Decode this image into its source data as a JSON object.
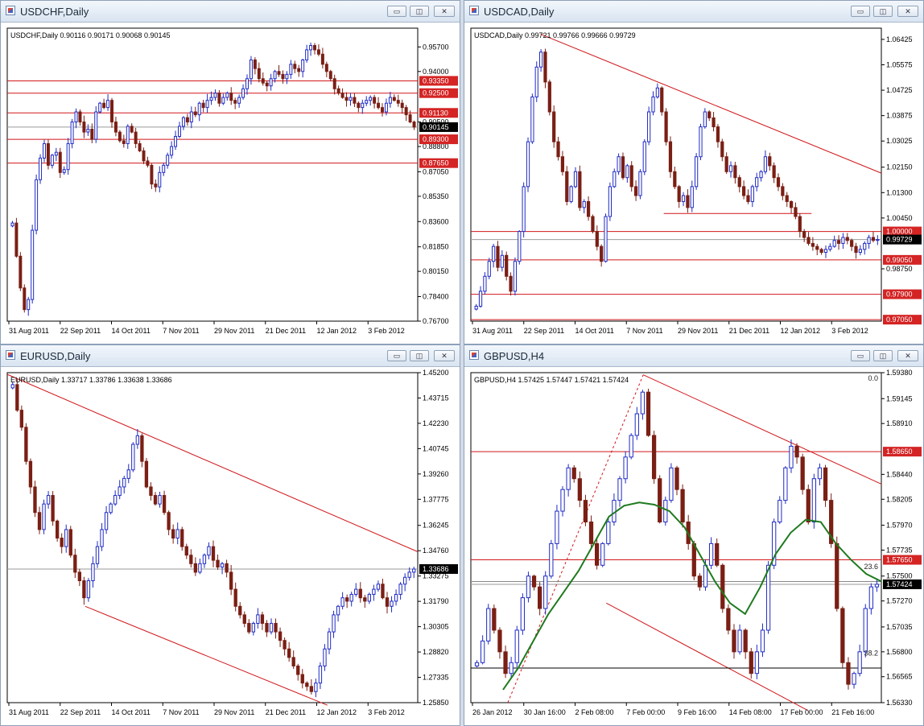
{
  "colors": {
    "up": "#1f2bc4",
    "down": "#7a1f14",
    "line": "#d1161a",
    "green": "#1f7a1f",
    "axis": "#000000",
    "price_box": "#d42424"
  },
  "window_controls": {
    "minimize": "▭",
    "restore": "◫",
    "close": "✕"
  },
  "chart_data": [
    {
      "id": "usdchf",
      "type": "candlestick",
      "window_title": "USDCHF,Daily",
      "info": "USDCHF,Daily  0.90116 0.90171 0.90068 0.90145",
      "ylim": [
        0.767,
        0.97
      ],
      "y_ticks": [
        {
          "v": 0.957,
          "t": "0.95700"
        },
        {
          "v": 0.94,
          "t": "0.94000"
        },
        {
          "v": 0.905,
          "t": "0.90500"
        },
        {
          "v": 0.888,
          "t": "0.88800"
        },
        {
          "v": 0.8705,
          "t": "0.87050"
        },
        {
          "v": 0.8535,
          "t": "0.85350"
        },
        {
          "v": 0.836,
          "t": "0.83600"
        },
        {
          "v": 0.8185,
          "t": "0.81850"
        },
        {
          "v": 0.8015,
          "t": "0.80150"
        },
        {
          "v": 0.784,
          "t": "0.78400"
        },
        {
          "v": 0.767,
          "t": "0.76700"
        }
      ],
      "x_ticks": [
        "31 Aug 2011",
        "22 Sep 2011",
        "14 Oct 2011",
        "7 Nov 2011",
        "29 Nov 2011",
        "21 Dec 2011",
        "12 Jan 2012",
        "3 Feb 2012"
      ],
      "h_lines": [
        {
          "v": 0.9335,
          "t": "0.93350"
        },
        {
          "v": 0.925,
          "t": "0.92500"
        },
        {
          "v": 0.9113,
          "t": "0.91130"
        },
        {
          "v": 0.893,
          "t": "0.89300"
        },
        {
          "v": 0.8765,
          "t": "0.87650"
        }
      ],
      "current": {
        "v": 0.90145,
        "t": "0.90145"
      },
      "closes": [
        0.835,
        0.812,
        0.79,
        0.775,
        0.782,
        0.83,
        0.865,
        0.88,
        0.89,
        0.875,
        0.882,
        0.884,
        0.87,
        0.872,
        0.89,
        0.905,
        0.912,
        0.905,
        0.898,
        0.9,
        0.893,
        0.912,
        0.918,
        0.915,
        0.92,
        0.905,
        0.898,
        0.892,
        0.89,
        0.902,
        0.898,
        0.89,
        0.885,
        0.878,
        0.875,
        0.862,
        0.86,
        0.87,
        0.875,
        0.882,
        0.888,
        0.895,
        0.902,
        0.908,
        0.905,
        0.912,
        0.91,
        0.918,
        0.915,
        0.92,
        0.922,
        0.925,
        0.918,
        0.922,
        0.925,
        0.92,
        0.918,
        0.922,
        0.928,
        0.935,
        0.948,
        0.942,
        0.935,
        0.932,
        0.93,
        0.935,
        0.94,
        0.938,
        0.935,
        0.938,
        0.945,
        0.942,
        0.94,
        0.948,
        0.955,
        0.958,
        0.955,
        0.952,
        0.945,
        0.94,
        0.935,
        0.928,
        0.925,
        0.922,
        0.92,
        0.922,
        0.918,
        0.915,
        0.918,
        0.92,
        0.922,
        0.918,
        0.915,
        0.912,
        0.918,
        0.922,
        0.92,
        0.918,
        0.915,
        0.91,
        0.905,
        0.90145
      ]
    },
    {
      "id": "usdcad",
      "type": "candlestick",
      "window_title": "USDCAD,Daily",
      "info": "USDCAD,Daily  0.99721 0.99766 0.99666 0.99729",
      "ylim": [
        0.97,
        1.068
      ],
      "y_ticks": [
        {
          "v": 1.06425,
          "t": "1.06425"
        },
        {
          "v": 1.05575,
          "t": "1.05575"
        },
        {
          "v": 1.04725,
          "t": "1.04725"
        },
        {
          "v": 1.03875,
          "t": "1.03875"
        },
        {
          "v": 1.03025,
          "t": "1.03025"
        },
        {
          "v": 1.0215,
          "t": "1.02150"
        },
        {
          "v": 1.013,
          "t": "1.01300"
        },
        {
          "v": 1.0045,
          "t": "1.00450"
        },
        {
          "v": 0.9875,
          "t": "0.98750"
        }
      ],
      "x_ticks": [
        "31 Aug 2011",
        "22 Sep 2011",
        "14 Oct 2011",
        "7 Nov 2011",
        "29 Nov 2011",
        "21 Dec 2011",
        "12 Jan 2012",
        "3 Feb 2012"
      ],
      "h_lines": [
        {
          "v": 1.0,
          "t": "1.00000"
        },
        {
          "v": 0.9905,
          "t": "0.99050"
        },
        {
          "v": 0.979,
          "t": "0.97900"
        },
        {
          "v": 0.9705,
          "t": "0.97050"
        }
      ],
      "current": {
        "v": 0.99729,
        "t": "0.99729"
      },
      "closes": [
        0.975,
        0.98,
        0.985,
        0.99,
        0.995,
        0.988,
        0.992,
        0.985,
        0.98,
        0.99,
        1.0,
        1.015,
        1.03,
        1.045,
        1.055,
        1.06,
        1.05,
        1.04,
        1.03,
        1.025,
        1.02,
        1.01,
        1.015,
        1.02,
        1.008,
        1.01,
        1.005,
        1.0,
        0.995,
        0.99,
        1.005,
        1.015,
        1.02,
        1.025,
        1.018,
        1.022,
        1.015,
        1.012,
        1.02,
        1.03,
        1.04,
        1.045,
        1.048,
        1.04,
        1.03,
        1.02,
        1.015,
        1.01,
        1.012,
        1.008,
        1.015,
        1.025,
        1.035,
        1.04,
        1.038,
        1.035,
        1.03,
        1.025,
        1.02,
        1.022,
        1.018,
        1.015,
        1.012,
        1.01,
        1.015,
        1.018,
        1.02,
        1.025,
        1.022,
        1.018,
        1.015,
        1.012,
        1.01,
        1.008,
        1.005,
        1.0,
        0.998,
        0.996,
        0.995,
        0.994,
        0.993,
        0.994,
        0.995,
        0.997,
        0.996,
        0.998,
        0.997,
        0.995,
        0.993,
        0.994,
        0.996,
        0.998,
        0.997,
        0.99729
      ]
    },
    {
      "id": "eurusd",
      "type": "candlestick",
      "window_title": "EURUSD,Daily",
      "info": "EURUSD,Daily  1.33717 1.33786 1.33638 1.33686",
      "ylim": [
        1.2585,
        1.452
      ],
      "y_ticks": [
        {
          "v": 1.452,
          "t": "1.45200"
        },
        {
          "v": 1.43715,
          "t": "1.43715"
        },
        {
          "v": 1.4223,
          "t": "1.42230"
        },
        {
          "v": 1.40745,
          "t": "1.40745"
        },
        {
          "v": 1.3926,
          "t": "1.39260"
        },
        {
          "v": 1.37775,
          "t": "1.37775"
        },
        {
          "v": 1.36245,
          "t": "1.36245"
        },
        {
          "v": 1.3476,
          "t": "1.34760"
        },
        {
          "v": 1.33275,
          "t": "1.33275"
        },
        {
          "v": 1.3179,
          "t": "1.31790"
        },
        {
          "v": 1.30305,
          "t": "1.30305"
        },
        {
          "v": 1.2882,
          "t": "1.28820"
        },
        {
          "v": 1.27335,
          "t": "1.27335"
        },
        {
          "v": 1.2585,
          "t": "1.25850"
        }
      ],
      "x_ticks": [
        "31 Aug 2011",
        "22 Sep 2011",
        "14 Oct 2011",
        "7 Nov 2011",
        "29 Nov 2011",
        "21 Dec 2011",
        "12 Jan 2012",
        "3 Feb 2012"
      ],
      "h_lines": [],
      "current": {
        "v": 1.33686,
        "t": "1.33686"
      },
      "closes": [
        1.445,
        1.43,
        1.42,
        1.4,
        1.385,
        1.37,
        1.36,
        1.375,
        1.38,
        1.365,
        1.355,
        1.35,
        1.36,
        1.345,
        1.335,
        1.33,
        1.32,
        1.33,
        1.34,
        1.35,
        1.36,
        1.37,
        1.375,
        1.38,
        1.385,
        1.39,
        1.395,
        1.41,
        1.415,
        1.4,
        1.385,
        1.38,
        1.375,
        1.38,
        1.37,
        1.36,
        1.355,
        1.36,
        1.35,
        1.345,
        1.34,
        1.335,
        1.34,
        1.345,
        1.35,
        1.342,
        1.338,
        1.34,
        1.335,
        1.325,
        1.315,
        1.31,
        1.305,
        1.3,
        1.305,
        1.31,
        1.305,
        1.3,
        1.305,
        1.3,
        1.295,
        1.29,
        1.285,
        1.28,
        1.275,
        1.27,
        1.268,
        1.265,
        1.27,
        1.28,
        1.29,
        1.3,
        1.31,
        1.315,
        1.32,
        1.318,
        1.322,
        1.325,
        1.32,
        1.318,
        1.322,
        1.325,
        1.328,
        1.32,
        1.315,
        1.318,
        1.322,
        1.328,
        1.332,
        1.335,
        1.33686
      ]
    },
    {
      "id": "gbpusd",
      "type": "candlestick",
      "window_title": "GBPUSD,H4",
      "info": "GBPUSD,H4  1.57425 1.57447 1.57421 1.57424",
      "ylim": [
        1.5633,
        1.5938
      ],
      "y_ticks": [
        {
          "v": 1.5938,
          "t": "1.59380"
        },
        {
          "v": 1.5914,
          "t": "1.59145"
        },
        {
          "v": 1.5891,
          "t": "1.58910"
        },
        {
          "v": 1.5844,
          "t": "1.58440"
        },
        {
          "v": 1.5821,
          "t": "1.58205"
        },
        {
          "v": 1.5797,
          "t": "1.57970"
        },
        {
          "v": 1.5774,
          "t": "1.57735"
        },
        {
          "v": 1.575,
          "t": "1.57500"
        },
        {
          "v": 1.5727,
          "t": "1.57270"
        },
        {
          "v": 1.5703,
          "t": "1.57035"
        },
        {
          "v": 1.568,
          "t": "1.56800"
        },
        {
          "v": 1.5657,
          "t": "1.56565"
        },
        {
          "v": 1.5633,
          "t": "1.56330"
        }
      ],
      "x_ticks": [
        "26 Jan 2012",
        "30 Jan 16:00",
        "2 Feb 08:00",
        "7 Feb 00:00",
        "9 Feb 16:00",
        "14 Feb 08:00",
        "17 Feb 00:00",
        "21 Feb 16:00"
      ],
      "h_lines": [
        {
          "v": 1.5865,
          "t": "1.58650"
        },
        {
          "v": 1.5765,
          "t": "1.57650"
        }
      ],
      "current": {
        "v": 1.57424,
        "t": "1.57424"
      },
      "fib_labels": [
        "0.0",
        "23.6",
        "38.2"
      ],
      "closes": [
        1.567,
        1.569,
        1.572,
        1.57,
        1.568,
        1.566,
        1.567,
        1.57,
        1.573,
        1.575,
        1.574,
        1.572,
        1.575,
        1.578,
        1.581,
        1.583,
        1.585,
        1.584,
        1.582,
        1.58,
        1.578,
        1.576,
        1.578,
        1.58,
        1.582,
        1.584,
        1.586,
        1.588,
        1.59,
        1.592,
        1.588,
        1.584,
        1.58,
        1.582,
        1.585,
        1.583,
        1.58,
        1.578,
        1.575,
        1.574,
        1.576,
        1.578,
        1.576,
        1.572,
        1.57,
        1.568,
        1.57,
        1.568,
        1.566,
        1.568,
        1.57,
        1.576,
        1.58,
        1.582,
        1.585,
        1.587,
        1.586,
        1.583,
        1.58,
        1.584,
        1.585,
        1.582,
        1.578,
        1.572,
        1.567,
        1.565,
        1.566,
        1.568,
        1.572,
        1.574,
        1.57424
      ],
      "sma": [
        1.5645,
        1.5665,
        1.569,
        1.5715,
        1.5735,
        1.5755,
        1.578,
        1.5805,
        1.5815,
        1.5818,
        1.5816,
        1.581,
        1.5795,
        1.577,
        1.5745,
        1.5725,
        1.5715,
        1.574,
        1.577,
        1.579,
        1.5802,
        1.58,
        1.578,
        1.5765,
        1.5752,
        1.5745
      ]
    }
  ]
}
